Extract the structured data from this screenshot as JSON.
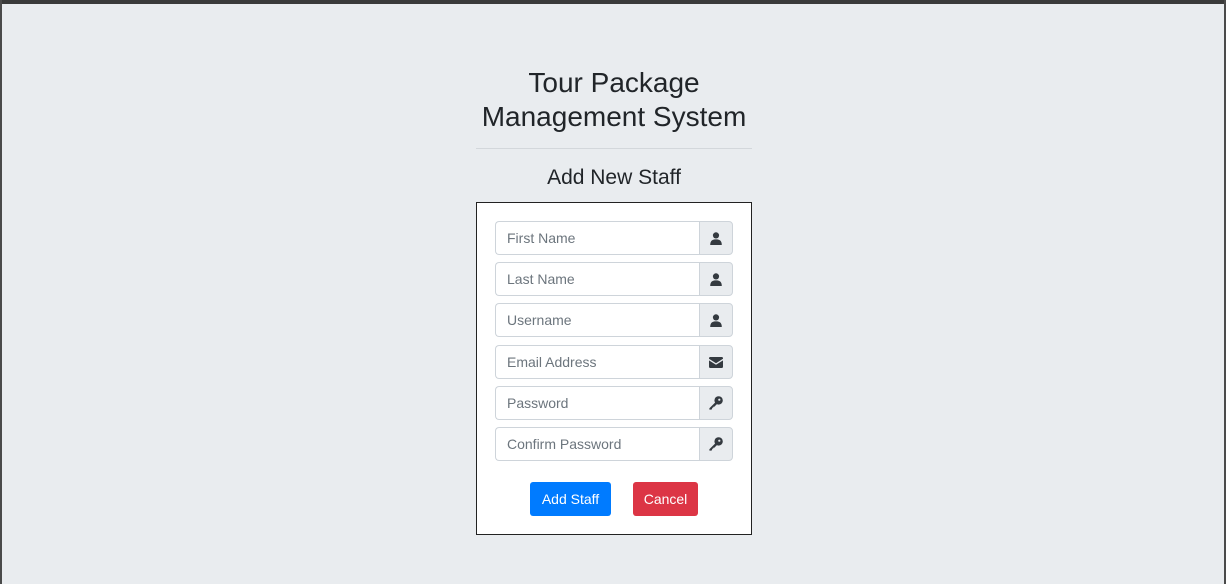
{
  "header": {
    "title_line1": "Tour Package",
    "title_line2": "Management System"
  },
  "form": {
    "title": "Add New Staff",
    "fields": [
      {
        "placeholder": "First Name",
        "value": "",
        "icon": "user-icon"
      },
      {
        "placeholder": "Last Name",
        "value": "",
        "icon": "user-icon"
      },
      {
        "placeholder": "Username",
        "value": "",
        "icon": "user-icon"
      },
      {
        "placeholder": "Email Address",
        "value": "",
        "icon": "envelope-icon"
      },
      {
        "placeholder": "Password",
        "value": "",
        "icon": "key-icon"
      },
      {
        "placeholder": "Confirm Password",
        "value": "",
        "icon": "key-icon"
      }
    ],
    "submit_label": "Add Staff",
    "cancel_label": "Cancel"
  },
  "colors": {
    "background": "#e9ecef",
    "primary": "#007bff",
    "danger": "#dc3545"
  }
}
